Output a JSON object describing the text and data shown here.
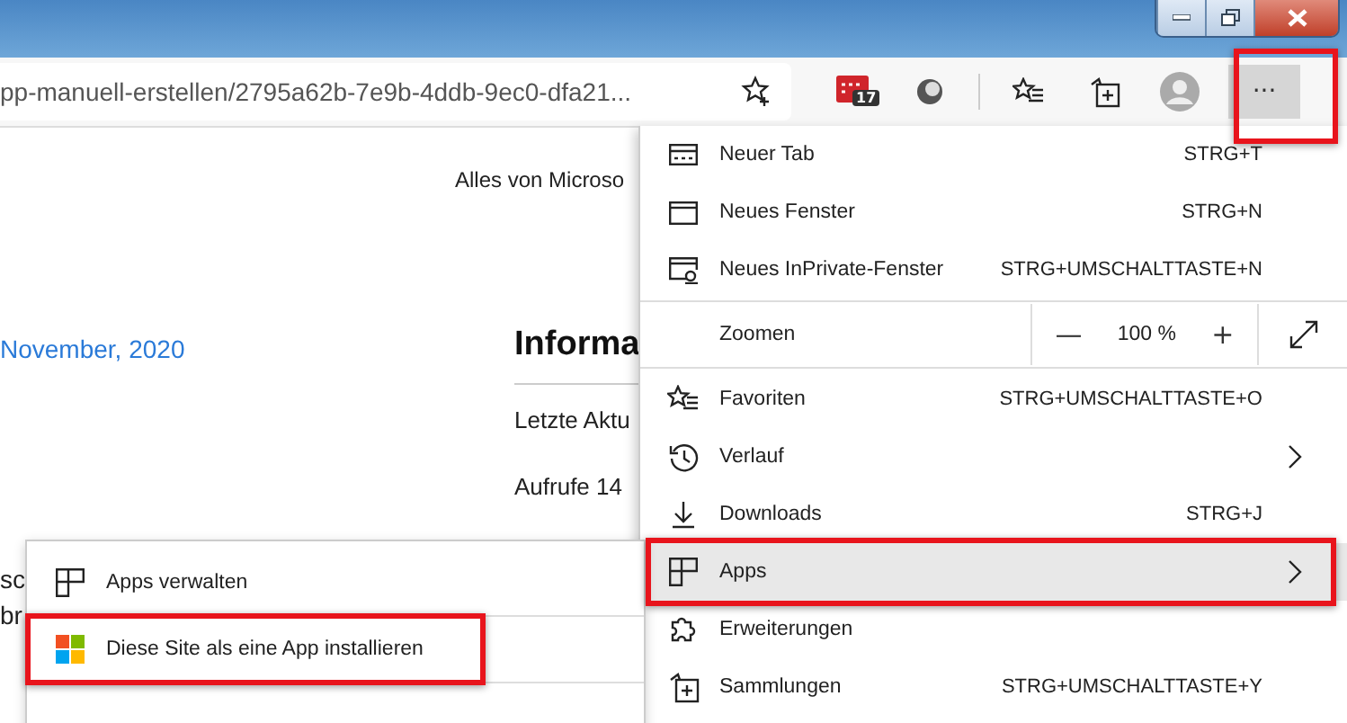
{
  "address_bar": {
    "url": "pp-manuell-erstellen/2795a62b-7e9b-4ddb-9ec0-dfa21..."
  },
  "toolbar": {
    "calendar_badge": "17",
    "more_button": {
      "label": "···",
      "highlighted": true
    }
  },
  "page": {
    "header_text": "Alles von Microso",
    "date_link": "November, 2020",
    "heading": "Informa",
    "info_lines": [
      "Letzte Aktu",
      "Aufrufe 14"
    ],
    "body_fragments": [
      "sc",
      "br"
    ]
  },
  "menu": {
    "items": [
      {
        "kind": "item",
        "label": "Neuer Tab",
        "shortcut": "STRG+T",
        "highlighted": false,
        "hovered": false
      },
      {
        "kind": "item",
        "label": "Neues Fenster",
        "shortcut": "STRG+N",
        "highlighted": false,
        "hovered": false
      },
      {
        "kind": "item",
        "label": "Neues InPrivate-Fenster",
        "shortcut": "STRG+UMSCHALTTASTE+N",
        "highlighted": false,
        "hovered": false
      },
      {
        "kind": "zoom",
        "label": "Zoomen",
        "minus": "—",
        "value": "100 %",
        "plus": "+"
      },
      {
        "kind": "item",
        "label": "Favoriten",
        "shortcut": "STRG+UMSCHALTTASTE+O",
        "highlighted": false,
        "hovered": false
      },
      {
        "kind": "submenu",
        "label": "Verlauf",
        "highlighted": false,
        "hovered": false
      },
      {
        "kind": "item",
        "label": "Downloads",
        "shortcut": "STRG+J",
        "highlighted": false,
        "hovered": false
      },
      {
        "kind": "submenu",
        "label": "Apps",
        "highlighted": true,
        "hovered": true
      },
      {
        "kind": "item",
        "label": "Erweiterungen",
        "highlighted": false,
        "hovered": false
      },
      {
        "kind": "item",
        "label": "Sammlungen",
        "shortcut": "STRG+UMSCHALTTASTE+Y",
        "highlighted": false,
        "hovered": false
      }
    ]
  },
  "apps_submenu": {
    "items": [
      {
        "label": "Apps verwalten",
        "highlighted": false
      },
      {
        "label": "Diese Site als eine App installieren",
        "highlighted": true
      }
    ]
  }
}
